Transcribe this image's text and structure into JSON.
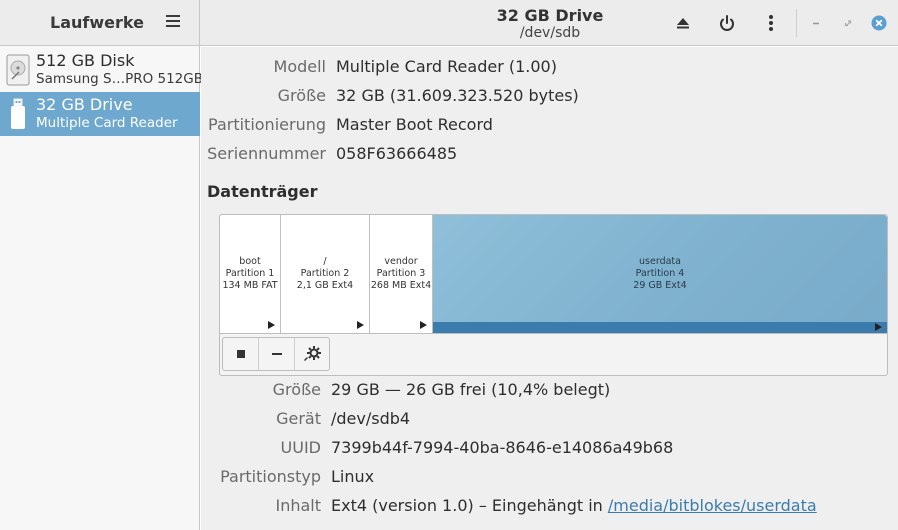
{
  "sidebar": {
    "title": "Laufwerke",
    "drives": [
      {
        "name": "512 GB Disk",
        "desc": "Samsung S…PRO 512GB"
      },
      {
        "name": "32 GB Drive",
        "desc": "Multiple Card  Reader"
      }
    ]
  },
  "header": {
    "title": "32 GB Drive",
    "subtitle": "/dev/sdb"
  },
  "drive_info": {
    "model_label": "Modell",
    "model_value": "Multiple Card  Reader (1.00)",
    "size_label": "Größe",
    "size_value": "32 GB (31.609.323.520 bytes)",
    "partitioning_label": "Partitionierung",
    "partitioning_value": "Master Boot Record",
    "serial_label": "Seriennummer",
    "serial_value": "058F63666485"
  },
  "volumes": {
    "title": "Datenträger",
    "partitions": [
      {
        "name": "boot",
        "number": "Partition 1",
        "size": "134 MB FAT"
      },
      {
        "name": "/",
        "number": "Partition 2",
        "size": "2,1 GB Ext4"
      },
      {
        "name": "vendor",
        "number": "Partition 3",
        "size": "268 MB Ext4"
      },
      {
        "name": "userdata",
        "number": "Partition 4",
        "size": "29 GB Ext4"
      }
    ]
  },
  "partition_info": {
    "size_label": "Größe",
    "size_value": "29 GB — 26 GB frei (10,4% belegt)",
    "device_label": "Gerät",
    "device_value": "/dev/sdb4",
    "uuid_label": "UUID",
    "uuid_value": "7399b44f-7994-40ba-8646-e14086a49b68",
    "type_label": "Partitionstyp",
    "type_value": "Linux",
    "content_label": "Inhalt",
    "content_prefix": "Ext4 (version 1.0) – Eingehängt in ",
    "content_link": "/media/bitblokes/userdata"
  },
  "colors": {
    "accent": "#6ea8cf",
    "selected_partition": "#8fbfd9",
    "link": "#3b7cae"
  },
  "icons": [
    "hamburger-icon",
    "eject-icon",
    "power-icon",
    "kebab-menu-icon",
    "minimize-icon",
    "maximize-icon",
    "close-icon",
    "hard-disk-icon",
    "usb-drive-icon",
    "stop-icon",
    "minus-icon",
    "gear-icon"
  ]
}
